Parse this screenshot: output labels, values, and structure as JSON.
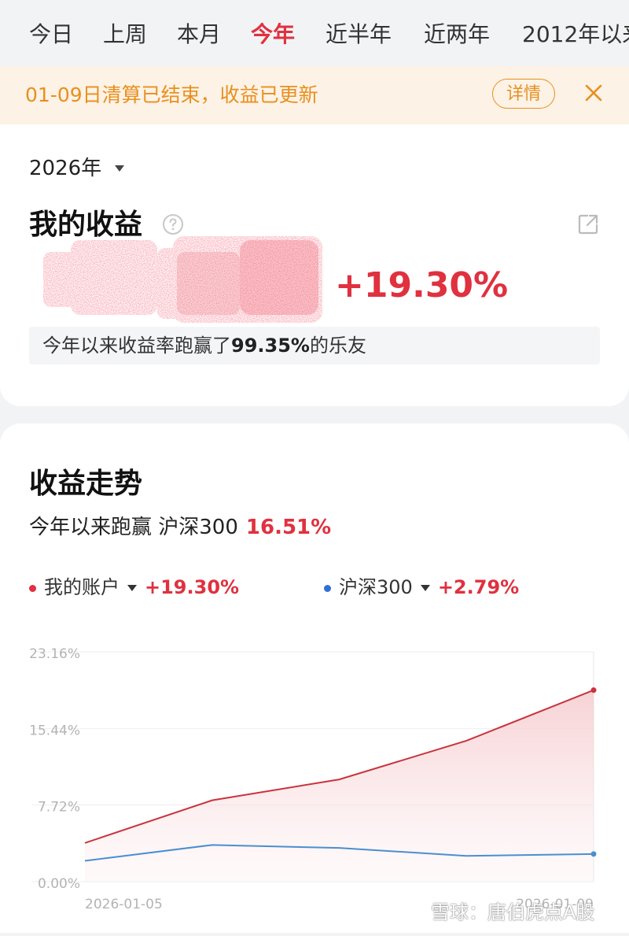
{
  "tabs": [
    {
      "label": "今日",
      "active": false
    },
    {
      "label": "上周",
      "active": false
    },
    {
      "label": "本月",
      "active": false
    },
    {
      "label": "今年",
      "active": true
    },
    {
      "label": "近半年",
      "active": false
    },
    {
      "label": "近两年",
      "active": false
    },
    {
      "label": "2012年以来",
      "active": false
    }
  ],
  "notice": {
    "text": "01-09日清算已结束，收益已更新",
    "detail_label": "详情",
    "close_icon": "close-icon"
  },
  "summary": {
    "year": "2026年",
    "title": "我的收益",
    "return_pct": "+19.30%",
    "rank_prefix": "今年以来收益率跑赢了",
    "rank_value": "99.35%",
    "rank_suffix": "的乐友"
  },
  "trend": {
    "title": "收益走势",
    "beat_text": "今年以来跑赢 沪深300",
    "beat_value": "16.51%",
    "legend": [
      {
        "name": "我的账户",
        "value": "+19.30%",
        "color": "#e0313f"
      },
      {
        "name": "沪深300",
        "value": "+2.79%",
        "color": "#2f6fd6"
      }
    ]
  },
  "chart_data": {
    "type": "area",
    "title": "",
    "xlabel": "",
    "ylabel": "",
    "x_tick_labels": [
      "2026-01-05",
      "2026-01-09"
    ],
    "y_tick_labels": [
      "23.16%",
      "15.44%",
      "7.72%",
      "0.00%"
    ],
    "y_ticks": [
      23.16,
      15.44,
      7.72,
      0.0
    ],
    "ylim": [
      0,
      23.16
    ],
    "x": [
      "2026-01-05",
      "2026-01-06",
      "2026-01-07",
      "2026-01-08",
      "2026-01-09"
    ],
    "series": [
      {
        "name": "我的账户",
        "color": "#c9333d",
        "values": [
          3.9,
          8.2,
          10.3,
          14.2,
          19.3
        ]
      },
      {
        "name": "沪深300",
        "color": "#4a8fd0",
        "values": [
          2.1,
          3.7,
          3.4,
          2.6,
          2.79
        ]
      }
    ],
    "grid": true
  },
  "watermark": "雪球：唐伯虎点A股"
}
